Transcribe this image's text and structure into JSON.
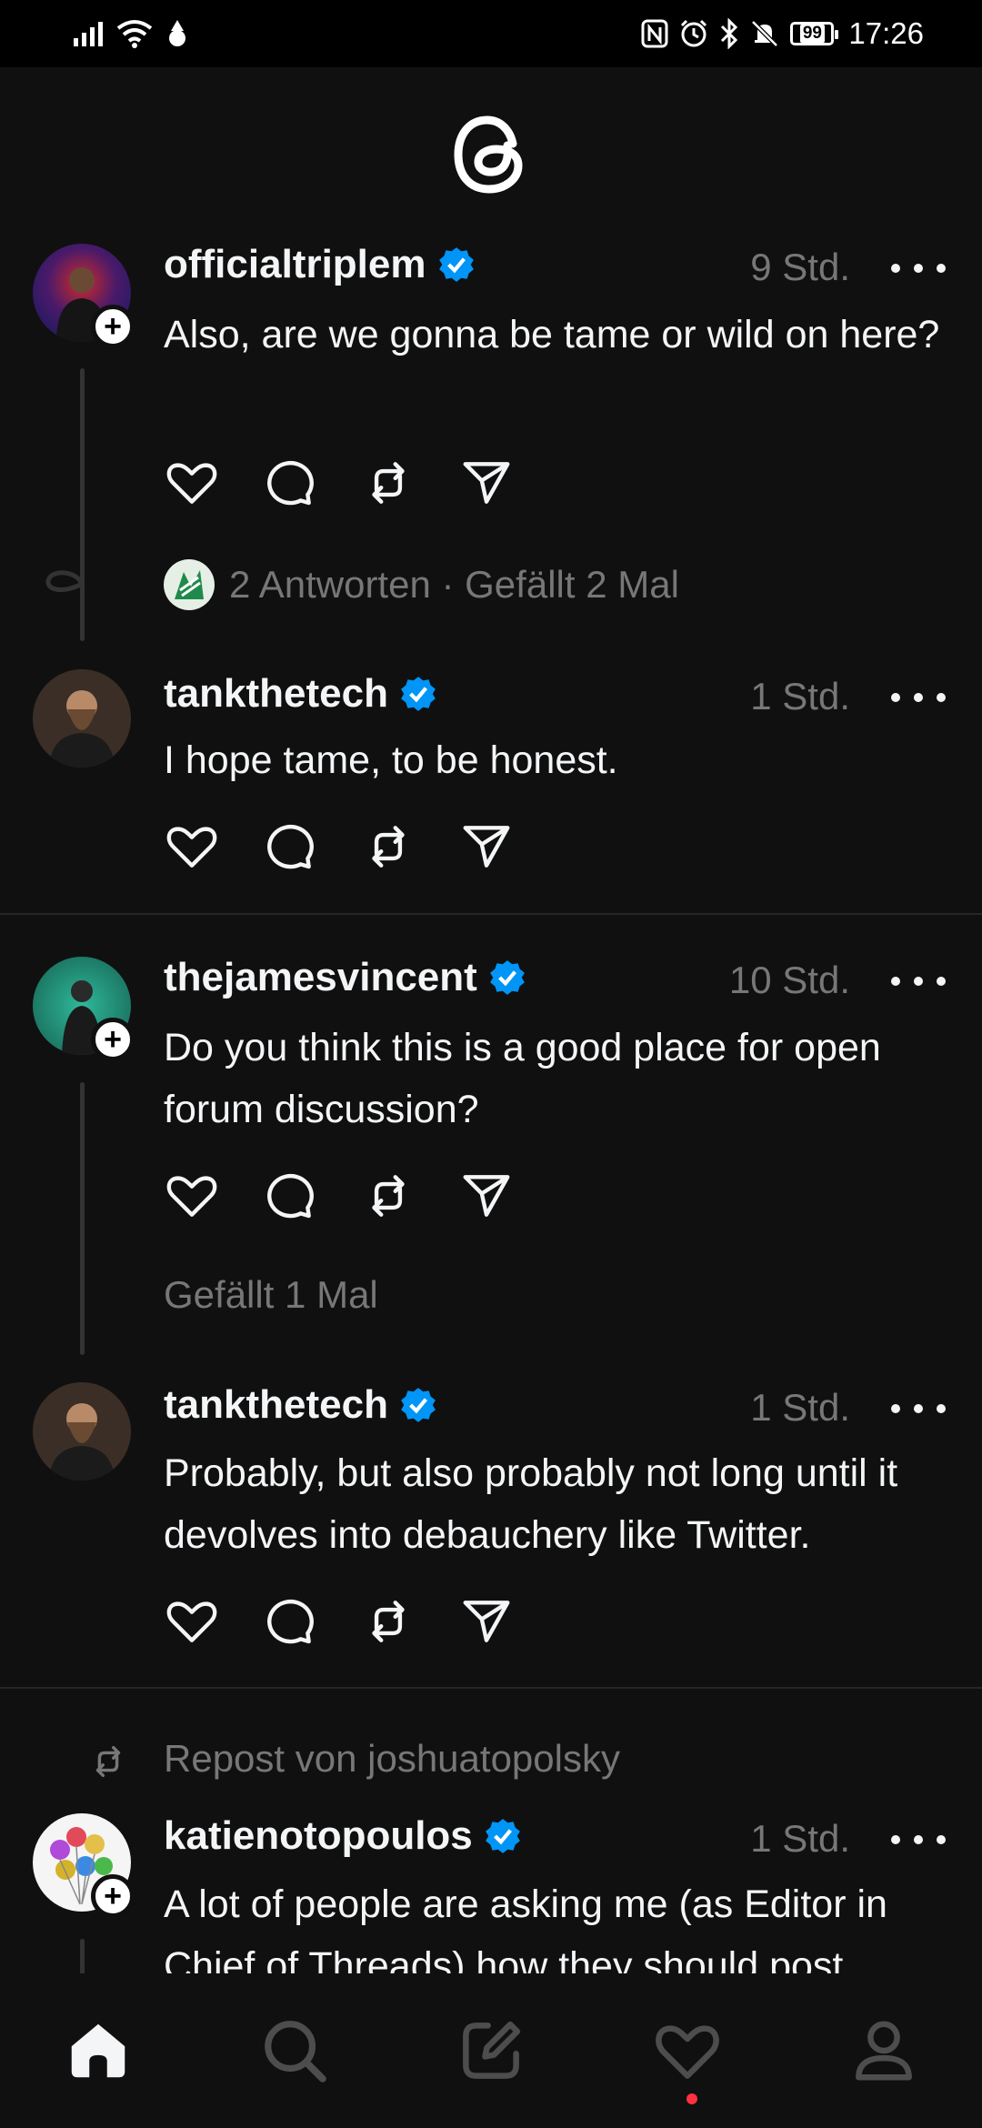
{
  "status_bar": {
    "battery": "99",
    "time": "17:26"
  },
  "posts": [
    {
      "username": "officialtriplem",
      "time": "9 Std.",
      "text": "Also, are we gonna be tame or wild on here?"
    },
    {
      "username": "tankthetech",
      "time": "1 Std.",
      "text": "I hope tame, to be honest."
    },
    {
      "username": "thejamesvincent",
      "time": "10 Std.",
      "text": "Do you think this is a good place for open forum discussion?"
    },
    {
      "username": "tankthetech",
      "time": "1 Std.",
      "text": "Probably, but also probably not long until it devolves into debauchery like Twitter."
    },
    {
      "username": "katienotopoulos",
      "time": "1 Std.",
      "text": "A lot of people are asking me (as Editor in Chief of Threads) how they should post"
    }
  ],
  "meta": {
    "post1": "2 Antworten · Gefällt 2 Mal",
    "post3": "Gefällt 1 Mal"
  },
  "repost_label": "Repost von joshuatopolsky",
  "nav": [
    "home-icon",
    "search-icon",
    "compose-icon",
    "heart-icon",
    "profile-icon"
  ],
  "colors": {
    "background": "#101010",
    "verified": "#0095f6",
    "secondary_text": "#777777",
    "notification_dot": "#ff3040"
  }
}
